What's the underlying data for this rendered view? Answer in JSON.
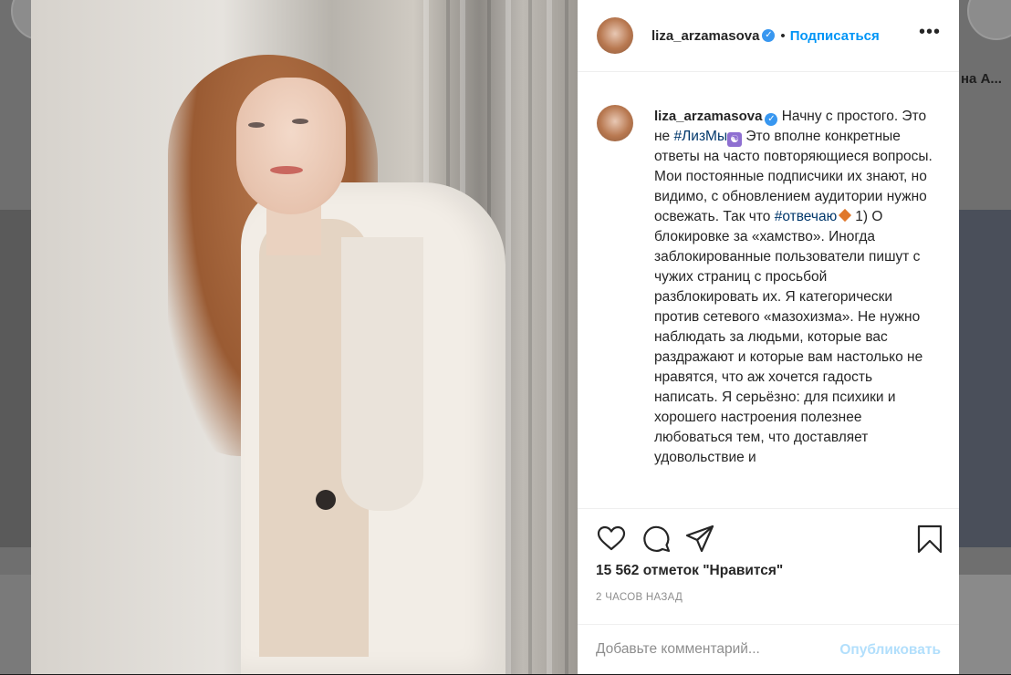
{
  "background": {
    "right_partial_text": "на А..."
  },
  "post": {
    "header": {
      "username": "liza_arzamasova",
      "verified_mark": "✓",
      "separator": "•",
      "follow_label": "Подписаться",
      "more_label": "•••"
    },
    "caption": {
      "username": "liza_arzamasova",
      "part1": " Начну с простого. Это не ",
      "hashtag1": "#ЛизМы",
      "emoji1": "☯",
      "part2": " Это вполне конкретные ответы на часто повторяющиеся вопросы. Мои постоянные подписчики их знают, но видимо, с обновлением аудитории нужно освежать. Так что ",
      "hashtag2": "#отвечаю",
      "part3": "1) О блокировке за «хамство». Иногда заблокированные пользователи пишут с чужих страниц с просьбой разблокировать их. Я категорически против сетевого «мазохизма». Не нужно наблюдать за людьми, которые вас раздражают и которые вам настолько не нравятся, что аж хочется гадость написать. Я серьёзно: для психики и хорошего настроения полезнее любоваться тем, что доставляет удовольствие и"
    },
    "likes_text": "15 562 отметок \"Нравится\"",
    "time_text": "2 ЧАСОВ НАЗАД",
    "comment": {
      "placeholder": "Добавьте комментарий...",
      "post_label": "Опубликовать"
    },
    "icons": {
      "like": "heart-icon",
      "comment": "comment-icon",
      "share": "share-icon",
      "save": "bookmark-icon"
    },
    "colors": {
      "accent": "#0095f6",
      "verified": "#3897f0",
      "hashtag": "#00376b",
      "post_disabled": "#b2dffc"
    }
  }
}
